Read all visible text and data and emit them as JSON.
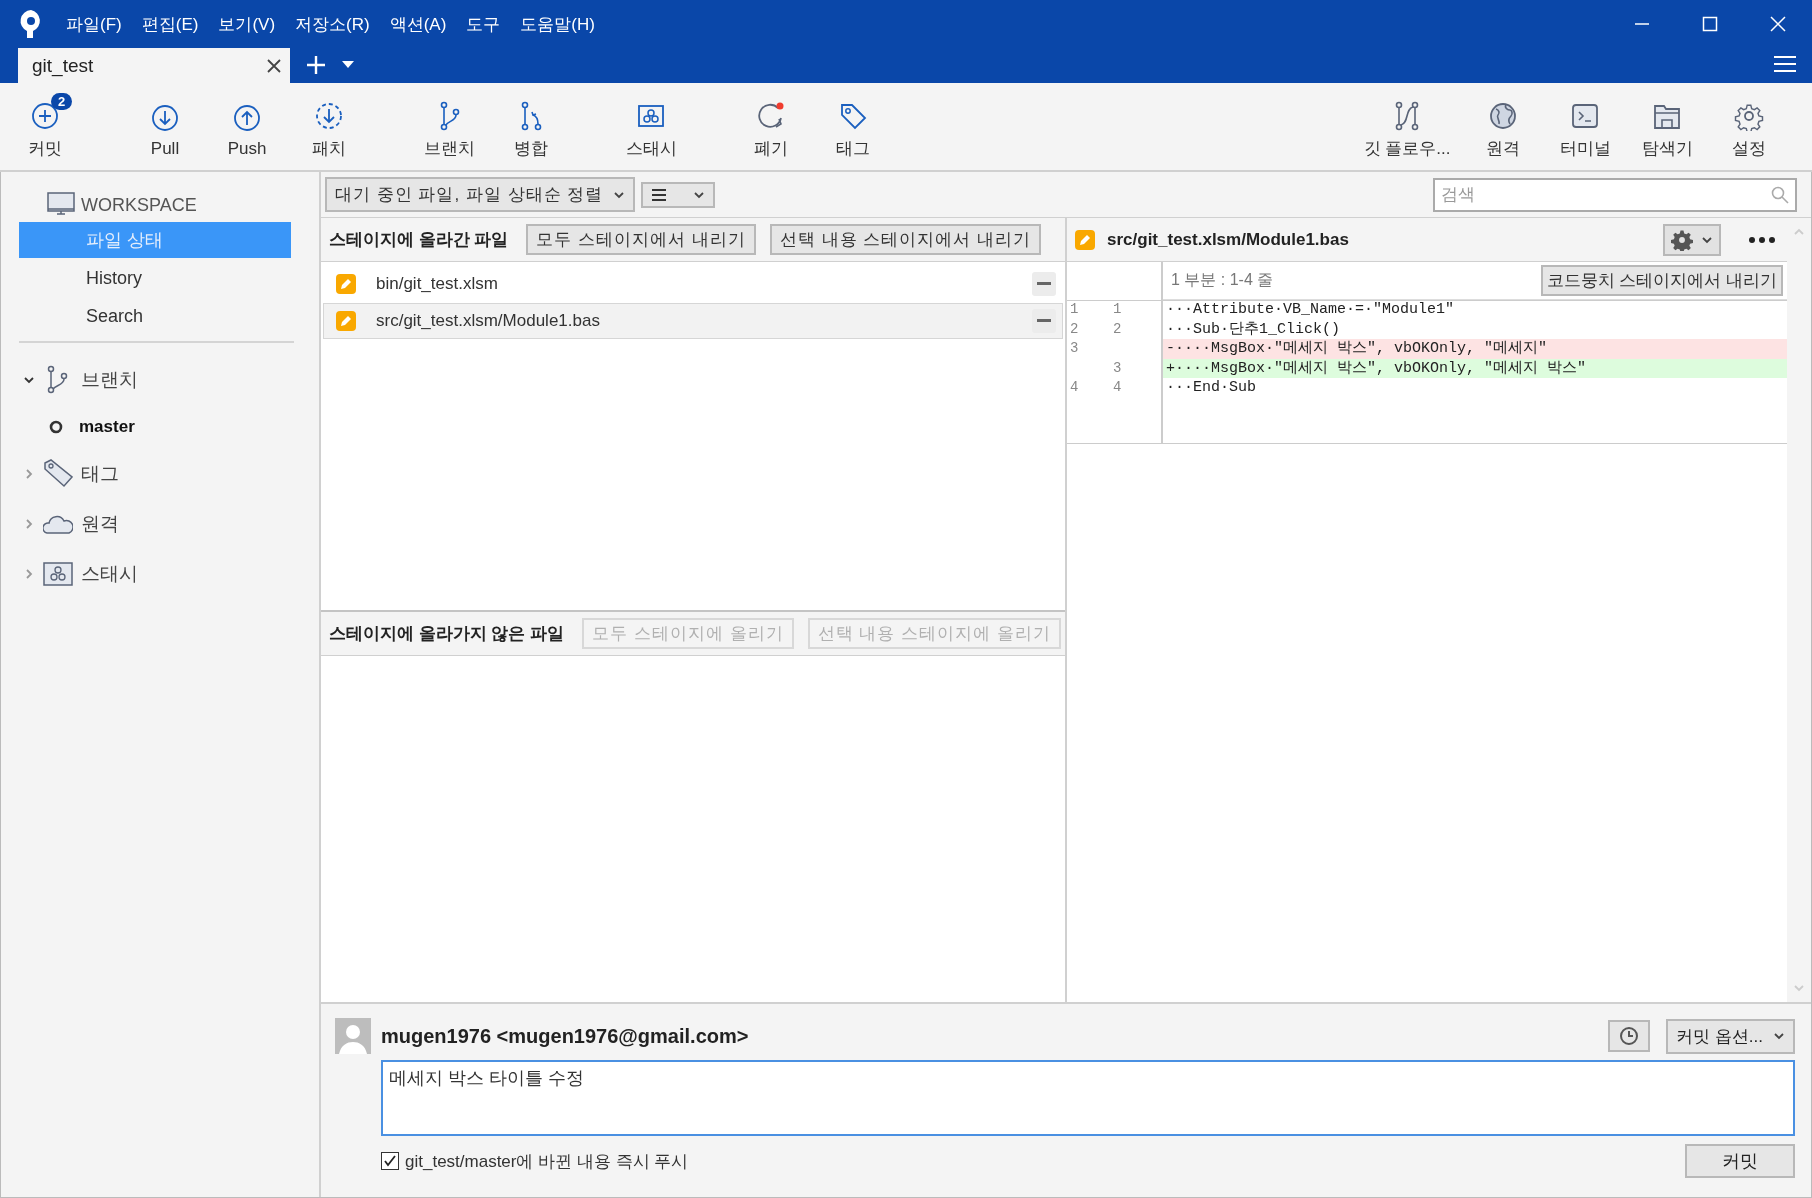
{
  "menu": [
    "파일(F)",
    "편집(E)",
    "보기(V)",
    "저장소(R)",
    "액션(A)",
    "도구",
    "도움말(H)"
  ],
  "tabs": [
    {
      "label": "git_test",
      "selected": true
    }
  ],
  "toolbar": {
    "left": [
      {
        "label": "커밋",
        "badge": "2"
      },
      {
        "label": "Pull"
      },
      {
        "label": "Push"
      },
      {
        "label": "패치"
      },
      {
        "label": "브랜치"
      },
      {
        "label": "병합"
      },
      {
        "label": "스태시"
      },
      {
        "label": "폐기"
      },
      {
        "label": "태그"
      }
    ],
    "right": [
      {
        "label": "깃 플로우..."
      },
      {
        "label": "원격"
      },
      {
        "label": "터미널"
      },
      {
        "label": "탐색기"
      },
      {
        "label": "설정"
      }
    ]
  },
  "sidebar": {
    "workspace": {
      "title": "WORKSPACE",
      "items": [
        {
          "label": "파일 상태",
          "selected": true
        },
        {
          "label": "History",
          "selected": false
        },
        {
          "label": "Search",
          "selected": false
        }
      ]
    },
    "sections": [
      {
        "label": "브랜치",
        "expanded": true,
        "children": [
          {
            "label": "master",
            "current": true
          }
        ]
      },
      {
        "label": "태그",
        "expanded": false
      },
      {
        "label": "원격",
        "expanded": false
      },
      {
        "label": "스태시",
        "expanded": false
      }
    ]
  },
  "filter": {
    "sort_dropdown": "대기 중인 파일, 파일 상태순 정렬"
  },
  "search": {
    "placeholder": "검색"
  },
  "staged": {
    "title": "스테이지에 올라간 파일",
    "buttons": [
      {
        "label": "모두 스테이지에서 내리기",
        "disabled": false
      },
      {
        "label": "선택 내용 스테이지에서 내리기",
        "disabled": false
      }
    ],
    "files": [
      {
        "path": "bin/git_test.xlsm",
        "selected": false
      },
      {
        "path": "src/git_test.xlsm/Module1.bas",
        "selected": true
      }
    ]
  },
  "unstaged": {
    "title": "스테이지에 올라가지 않은 파일",
    "buttons": [
      {
        "label": "모두 스테이지에 올리기",
        "disabled": true
      },
      {
        "label": "선택 내용 스테이지에 올리기",
        "disabled": true
      }
    ]
  },
  "diff": {
    "file": "src/git_test.xlsm/Module1.bas",
    "hunk": {
      "header": "1 부분 : 1-4 줄",
      "button": "코드뭉치 스테이지에서 내리기"
    },
    "lines": [
      {
        "kind": "context",
        "old": "1",
        "new": "1",
        "text": "···Attribute·VB_Name·=·\"Module1\""
      },
      {
        "kind": "context",
        "old": "2",
        "new": "2",
        "text": "···Sub·단추1_Click()"
      },
      {
        "kind": "removed",
        "old": "3",
        "text": "-····MsgBox·\"메세지 박스\", vbOKOnly, \"메세지\""
      },
      {
        "kind": "added",
        "new": "3",
        "text": "+····MsgBox·\"메세지 박스\", vbOKOnly, \"메세지 박스\""
      },
      {
        "kind": "context",
        "old": "4",
        "new": "4",
        "text": "···End·Sub"
      }
    ]
  },
  "commit": {
    "author": "mugen1976 <mugen1976@gmail.com>",
    "options": "커밋 옵션...",
    "message": "메세지 박스 타이틀 수정",
    "push_option": {
      "label": "git_test/master에 바뀐 내용 즉시 푸시",
      "checked": true
    },
    "button": "커밋"
  }
}
